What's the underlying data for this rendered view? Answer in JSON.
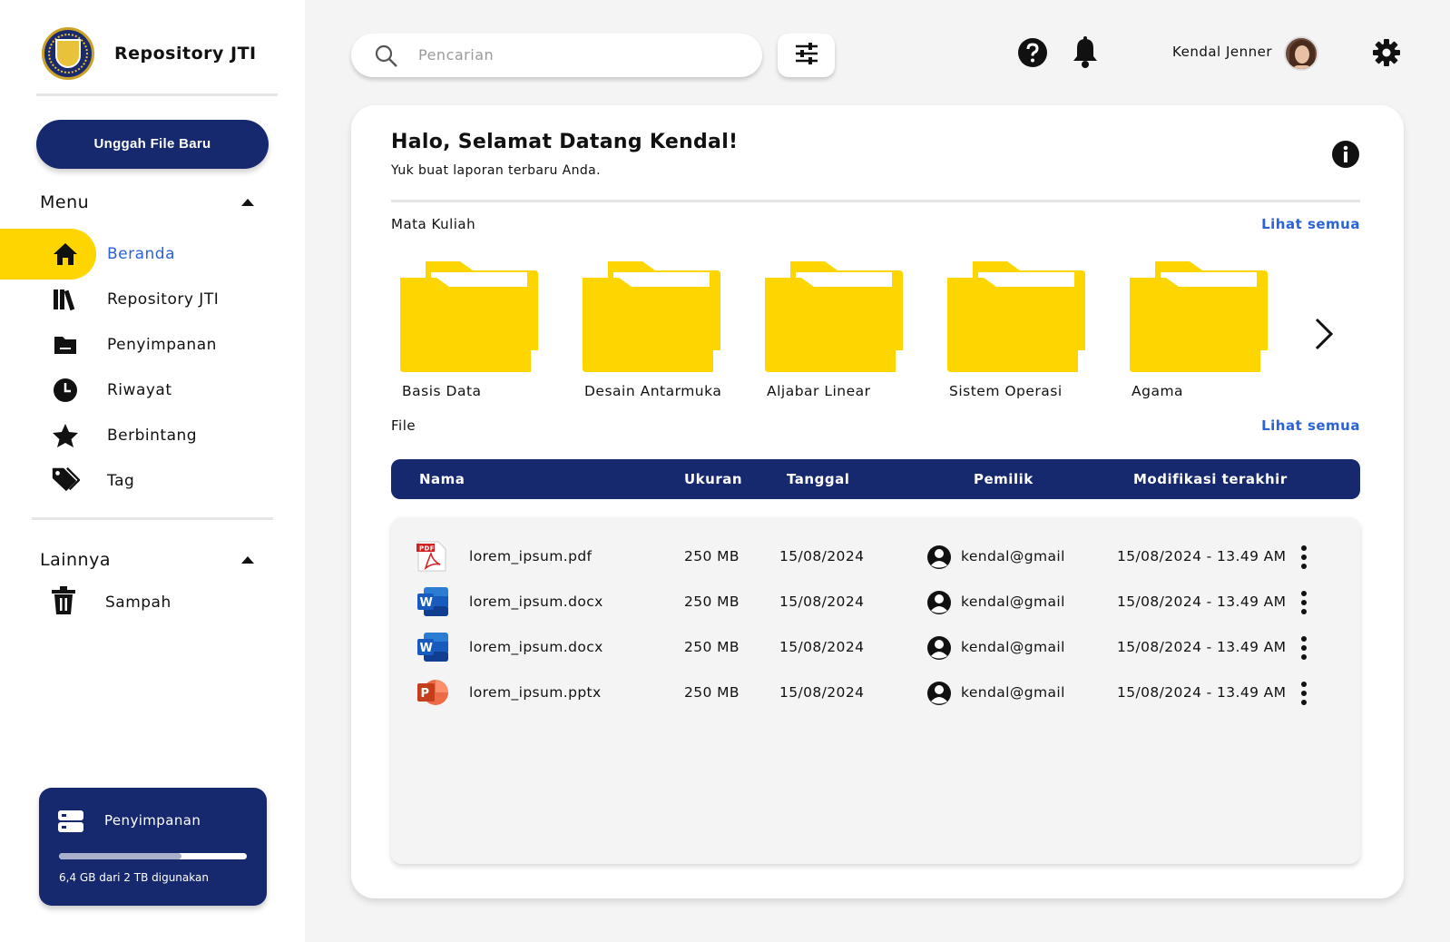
{
  "brand": {
    "name": "Repository JTI"
  },
  "upload_button": "Unggah File Baru",
  "menu": {
    "title": "Menu",
    "items": [
      {
        "label": "Beranda",
        "icon": "home-icon",
        "active": true
      },
      {
        "label": "Repository JTI",
        "icon": "books-icon"
      },
      {
        "label": "Penyimpanan",
        "icon": "folder-icon"
      },
      {
        "label": "Riwayat",
        "icon": "clock-icon"
      },
      {
        "label": "Berbintang",
        "icon": "star-icon"
      },
      {
        "label": "Tag",
        "icon": "tag-icon"
      }
    ]
  },
  "others": {
    "title": "Lainnya",
    "items": [
      {
        "label": "Sampah",
        "icon": "trash-icon"
      }
    ]
  },
  "storage": {
    "title": "Penyimpanan",
    "usage_text": "6,4 GB dari 2 TB digunakan",
    "used_fraction": 0.65
  },
  "search": {
    "placeholder": "Pencarian"
  },
  "user": {
    "name": "Kendal Jenner"
  },
  "welcome": {
    "title": "Halo, Selamat Datang Kendal!",
    "subtitle": "Yuk buat laporan terbaru Anda."
  },
  "courses": {
    "label": "Mata Kuliah",
    "see_all": "Lihat semua",
    "folders": [
      "Basis Data",
      "Desain Antarmuka",
      "Aljabar Linear",
      "Sistem Operasi",
      "Agama"
    ]
  },
  "files": {
    "label": "File",
    "see_all": "Lihat semua",
    "columns": [
      "Nama",
      "Ukuran",
      "Tanggal",
      "Pemilik",
      "Modifikasi terakhir"
    ],
    "rows": [
      {
        "type": "pdf",
        "name": "lorem_ipsum.pdf",
        "size": "250 MB",
        "date": "15/08/2024",
        "owner": "kendal@gmail",
        "modified": "15/08/2024 - 13.49 AM"
      },
      {
        "type": "docx",
        "name": "lorem_ipsum.docx",
        "size": "250 MB",
        "date": "15/08/2024",
        "owner": "kendal@gmail",
        "modified": "15/08/2024 - 13.49 AM"
      },
      {
        "type": "docx",
        "name": "lorem_ipsum.docx",
        "size": "250 MB",
        "date": "15/08/2024",
        "owner": "kendal@gmail",
        "modified": "15/08/2024 - 13.49 AM"
      },
      {
        "type": "pptx",
        "name": "lorem_ipsum.pptx",
        "size": "250 MB",
        "date": "15/08/2024",
        "owner": "kendal@gmail",
        "modified": "15/08/2024 - 13.49 AM"
      }
    ]
  },
  "colors": {
    "navy": "#16286e",
    "yellow": "#ffd500",
    "link": "#2b63d6"
  }
}
